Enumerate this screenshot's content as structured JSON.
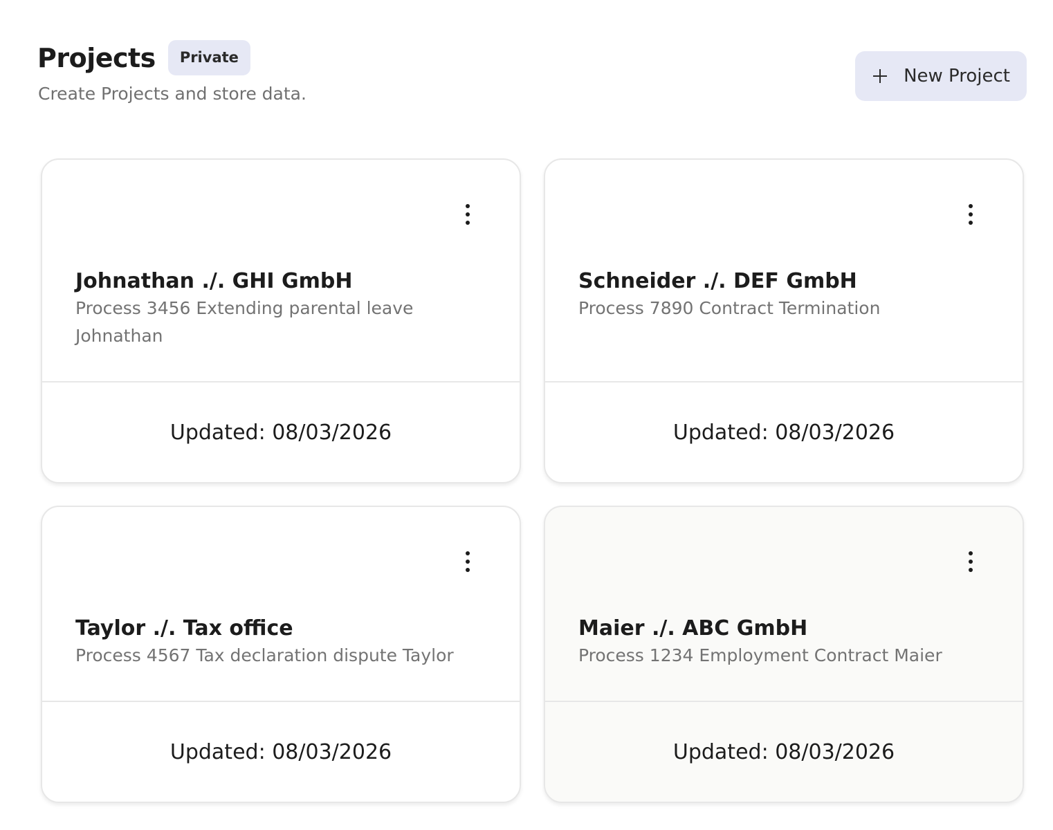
{
  "header": {
    "title": "Projects",
    "badge": "Private",
    "subtitle": "Create Projects and store data."
  },
  "toolbar": {
    "new_project_label": "New Project"
  },
  "projects": [
    {
      "title": "Johnathan ./. GHI GmbH",
      "description": "Process 3456 Extending parental leave Johnathan",
      "updated": "Updated: 08/03/2026"
    },
    {
      "title": "Schneider ./. DEF GmbH",
      "description": "Process 7890 Contract Termination",
      "updated": "Updated: 08/03/2026"
    },
    {
      "title": "Taylor ./. Tax office",
      "description": "Process 4567 Tax declaration dispute Taylor",
      "updated": "Updated: 08/03/2026"
    },
    {
      "title": "Maier ./. ABC GmbH",
      "description": "Process 1234 Employment Contract Maier",
      "updated": "Updated: 08/03/2026"
    }
  ]
}
